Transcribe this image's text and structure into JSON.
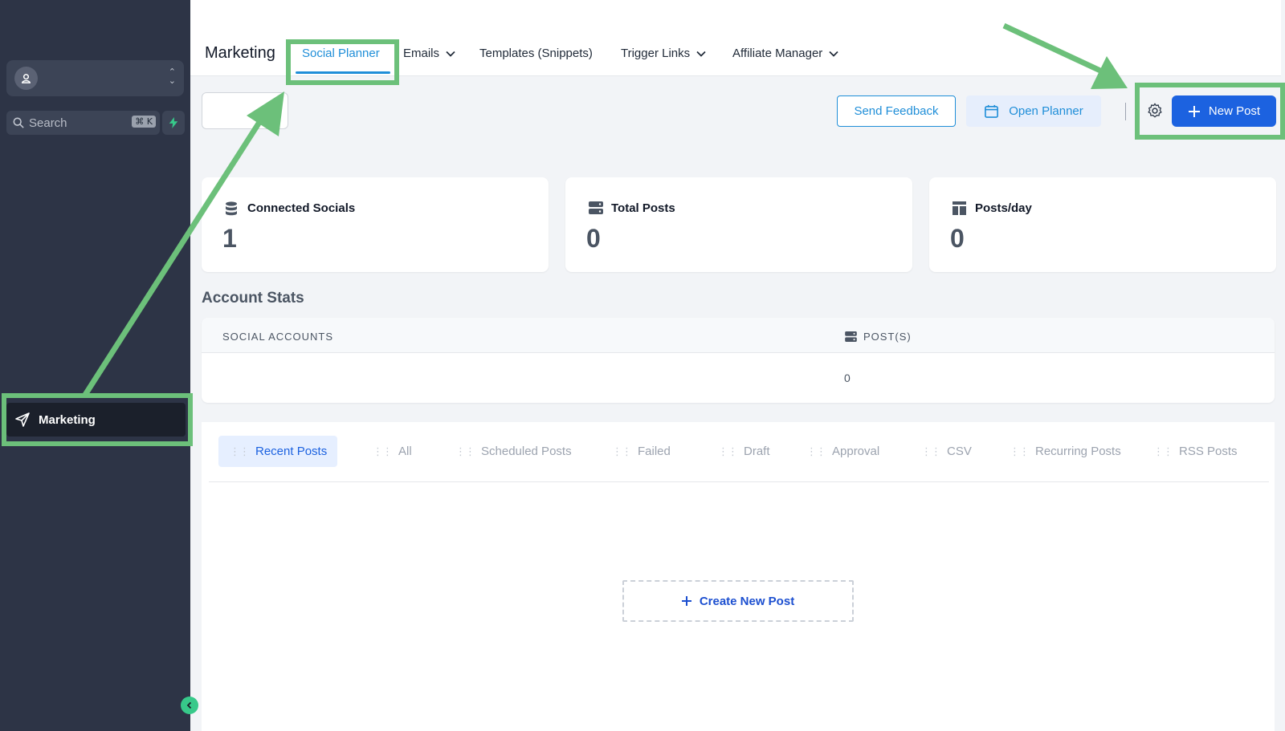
{
  "sidebar": {
    "search_placeholder": "Search",
    "search_shortcut": "⌘ K",
    "nav_marketing": "Marketing"
  },
  "topbar": {
    "title": "Marketing",
    "tabs": [
      {
        "label": "Social Planner",
        "active": true,
        "dropdown": false
      },
      {
        "label": "Emails",
        "dropdown": true
      },
      {
        "label": "Templates (Snippets)",
        "dropdown": false
      },
      {
        "label": "Trigger Links",
        "dropdown": true
      },
      {
        "label": "Affiliate Manager",
        "dropdown": true
      }
    ]
  },
  "toolbar": {
    "send_feedback": "Send Feedback",
    "open_planner": "Open Planner",
    "new_post": "New Post"
  },
  "stats": [
    {
      "label": "Connected Socials",
      "value": "1",
      "icon": "database-icon"
    },
    {
      "label": "Total Posts",
      "value": "0",
      "icon": "server-icon"
    },
    {
      "label": "Posts/day",
      "value": "0",
      "icon": "layout-icon"
    }
  ],
  "account_stats": {
    "title": "Account Stats",
    "col_social": "SOCIAL ACCOUNTS",
    "col_posts": "POST(S)",
    "row_posts": "0"
  },
  "post_tabs": [
    "Recent Posts",
    "All",
    "Scheduled Posts",
    "Failed",
    "Draft",
    "Approval",
    "CSV",
    "Recurring Posts",
    "RSS Posts"
  ],
  "create_new_post": "Create New Post",
  "colors": {
    "sidebar": "#2d3446",
    "accent": "#1f8ed8",
    "primary_button": "#1c62e0",
    "annotation": "#6cc07a"
  }
}
